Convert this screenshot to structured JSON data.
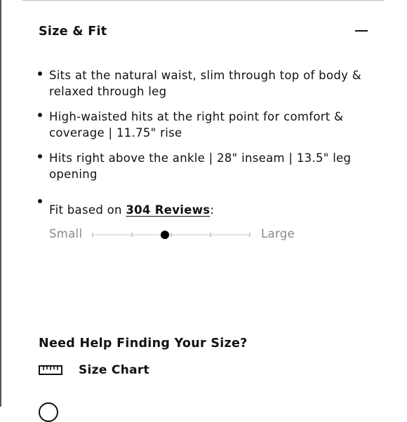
{
  "section": {
    "title": "Size & Fit",
    "toggle_icon": "minus-icon"
  },
  "details": {
    "bullets": [
      "Sits at the natural waist, slim through top of body & relaxed through leg",
      "High-waisted hits at the right point for comfort & coverage | 11.75\" rise",
      "Hits right above the ankle | 28\" inseam | 13.5\" leg opening"
    ]
  },
  "fit": {
    "prefix": "Fit based on ",
    "reviews_link": "304 Reviews",
    "suffix": ":",
    "scale_min_label": "Small",
    "scale_max_label": "Large",
    "tick_count": 5,
    "position": 0.46
  },
  "help": {
    "heading": "Need Help Finding Your Size?",
    "size_chart_label": "Size Chart",
    "size_chart_icon": "ruler-icon"
  },
  "colors": {
    "text": "#111111",
    "muted": "#8a8a8a",
    "track": "#e4e4e4"
  }
}
